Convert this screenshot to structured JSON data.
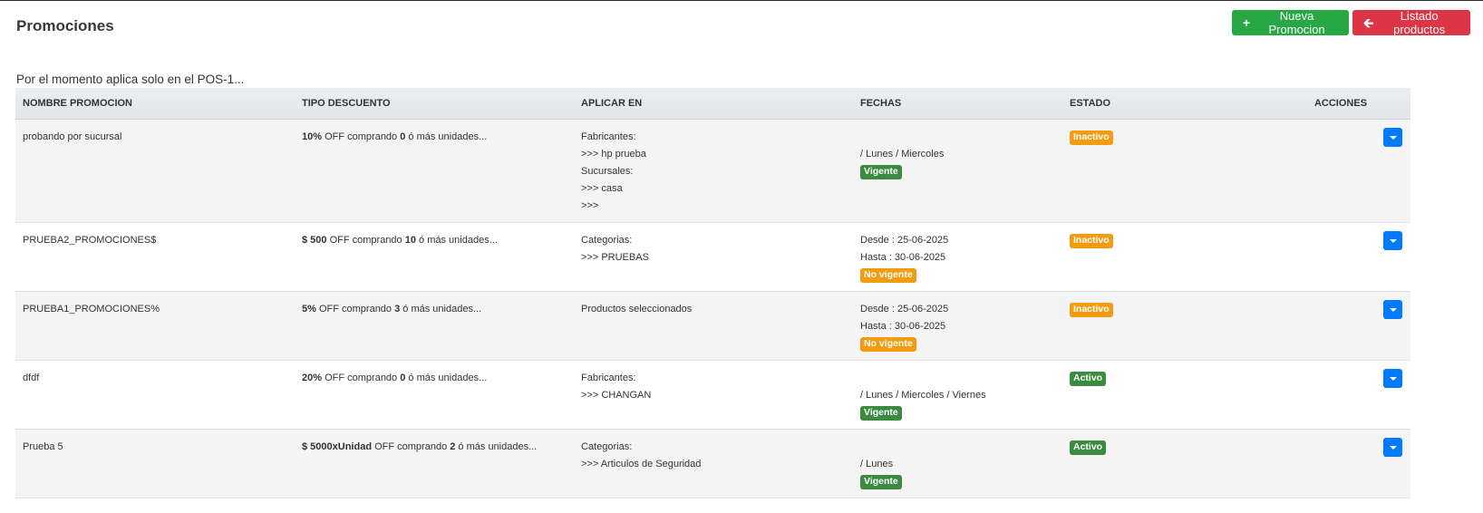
{
  "page": {
    "title": "Promociones",
    "note": "Por el momento aplica solo en el POS-1..."
  },
  "actions": {
    "new_label": "Nueva Promocion",
    "list_label": "Listado productos"
  },
  "colors": {
    "green": "#28a745",
    "red": "#dc3545",
    "blue": "#007bff",
    "orange": "#f39c12"
  },
  "table": {
    "headers": [
      "NOMBRE PROMOCION",
      "TIPO DESCUENTO",
      "APLICAR EN",
      "FECHAS",
      "ESTADO",
      "ACCIONES"
    ],
    "rows": [
      {
        "name": "probando por sucursal",
        "discount": {
          "value": "10%",
          "mid": " OFF comprando ",
          "qty": "0",
          "suffix": " ó más unidades..."
        },
        "apply": [
          "Fabricantes:",
          ">>> hp prueba",
          "Sucursales:",
          ">>> casa",
          ">>>"
        ],
        "dates": [
          "",
          "/ Lunes / Miercoles"
        ],
        "vigencia": "Vigente",
        "estado": "Inactivo"
      },
      {
        "name": "PRUEBA2_PROMOCIONES$",
        "discount": {
          "value": "$ 500",
          "mid": " OFF comprando ",
          "qty": "10",
          "suffix": " ó más unidades..."
        },
        "apply": [
          "Categorias:",
          ">>> PRUEBAS"
        ],
        "dates": [
          "Desde : 25-06-2025",
          "Hasta : 30-06-2025"
        ],
        "vigencia": "No vigente",
        "estado": "Inactivo"
      },
      {
        "name": "PRUEBA1_PROMOCIONES%",
        "discount": {
          "value": "5%",
          "mid": " OFF comprando ",
          "qty": "3",
          "suffix": " ó más unidades..."
        },
        "apply": [
          "Productos seleccionados"
        ],
        "dates": [
          "Desde : 25-06-2025",
          "Hasta : 30-06-2025"
        ],
        "vigencia": "No vigente",
        "estado": "Inactivo"
      },
      {
        "name": "dfdf",
        "discount": {
          "value": "20%",
          "mid": " OFF comprando ",
          "qty": "0",
          "suffix": " ó más unidades..."
        },
        "apply": [
          "Fabricantes:",
          ">>> CHANGAN"
        ],
        "dates": [
          "",
          "/ Lunes / Miercoles / Viernes"
        ],
        "vigencia": "Vigente",
        "estado": "Activo"
      },
      {
        "name": "Prueba 5",
        "discount": {
          "value": "$ 5000xUnidad",
          "mid": " OFF comprando ",
          "qty": "2",
          "suffix": " ó más unidades..."
        },
        "apply": [
          "Categorias:",
          ">>> Articulos de Seguridad"
        ],
        "dates": [
          "",
          "/ Lunes"
        ],
        "vigencia": "Vigente",
        "estado": "Activo"
      }
    ]
  }
}
